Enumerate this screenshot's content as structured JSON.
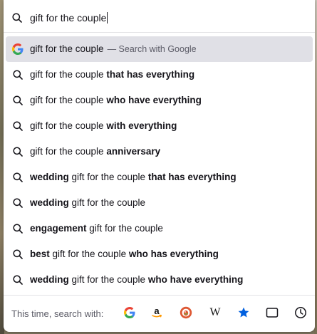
{
  "urlbar": {
    "query": "gift for the couple"
  },
  "rows": [
    {
      "segments": [
        {
          "t": "gift for the couple",
          "b": false
        }
      ],
      "sep": "— Search with Google",
      "icon": "google-icon",
      "selected": true
    },
    {
      "segments": [
        {
          "t": "gift for the couple ",
          "b": false
        },
        {
          "t": "that has everything",
          "b": true
        }
      ],
      "icon": "search-icon"
    },
    {
      "segments": [
        {
          "t": "gift for the couple ",
          "b": false
        },
        {
          "t": "who have everything",
          "b": true
        }
      ],
      "icon": "search-icon"
    },
    {
      "segments": [
        {
          "t": "gift for the couple ",
          "b": false
        },
        {
          "t": "with everything",
          "b": true
        }
      ],
      "icon": "search-icon"
    },
    {
      "segments": [
        {
          "t": "gift for the couple ",
          "b": false
        },
        {
          "t": "anniversary",
          "b": true
        }
      ],
      "icon": "search-icon"
    },
    {
      "segments": [
        {
          "t": "wedding",
          "b": true
        },
        {
          "t": " gift for the couple ",
          "b": false
        },
        {
          "t": "that has everything",
          "b": true
        }
      ],
      "icon": "search-icon"
    },
    {
      "segments": [
        {
          "t": "wedding",
          "b": true
        },
        {
          "t": " gift for the couple",
          "b": false
        }
      ],
      "icon": "search-icon"
    },
    {
      "segments": [
        {
          "t": "engagement",
          "b": true
        },
        {
          "t": " gift for the couple",
          "b": false
        }
      ],
      "icon": "search-icon",
      "fade": true
    },
    {
      "segments": [
        {
          "t": "best",
          "b": true
        },
        {
          "t": " gift for the couple ",
          "b": false
        },
        {
          "t": "who has everything",
          "b": true
        }
      ],
      "icon": "search-icon"
    },
    {
      "segments": [
        {
          "t": "wedding",
          "b": true
        },
        {
          "t": " gift for the couple ",
          "b": false
        },
        {
          "t": "who have everything",
          "b": true
        }
      ],
      "icon": "search-icon",
      "fade": true
    }
  ],
  "footer": {
    "label": "This time, search with:",
    "engines": [
      {
        "name": "google-engine-button",
        "icon": "google-icon"
      },
      {
        "name": "amazon-engine-button",
        "icon": "amazon-icon"
      },
      {
        "name": "duckduckgo-engine-button",
        "icon": "duckduckgo-icon"
      },
      {
        "name": "wikipedia-engine-button",
        "icon": "wikipedia-icon",
        "glyph": "W"
      },
      {
        "name": "bookmarks-button",
        "icon": "star-icon"
      },
      {
        "name": "tabs-button",
        "icon": "tab-icon"
      },
      {
        "name": "history-button",
        "icon": "clock-icon"
      }
    ]
  },
  "colors": {
    "text": "#15141a",
    "muted": "#5b5b66",
    "selected_bg": "#e0e0e6",
    "accent_blue": "#0060df",
    "google_blue": "#4285F4",
    "google_red": "#EA4335",
    "google_yellow": "#FBBC05",
    "google_green": "#34A853",
    "ddg_orange": "#de5833"
  }
}
